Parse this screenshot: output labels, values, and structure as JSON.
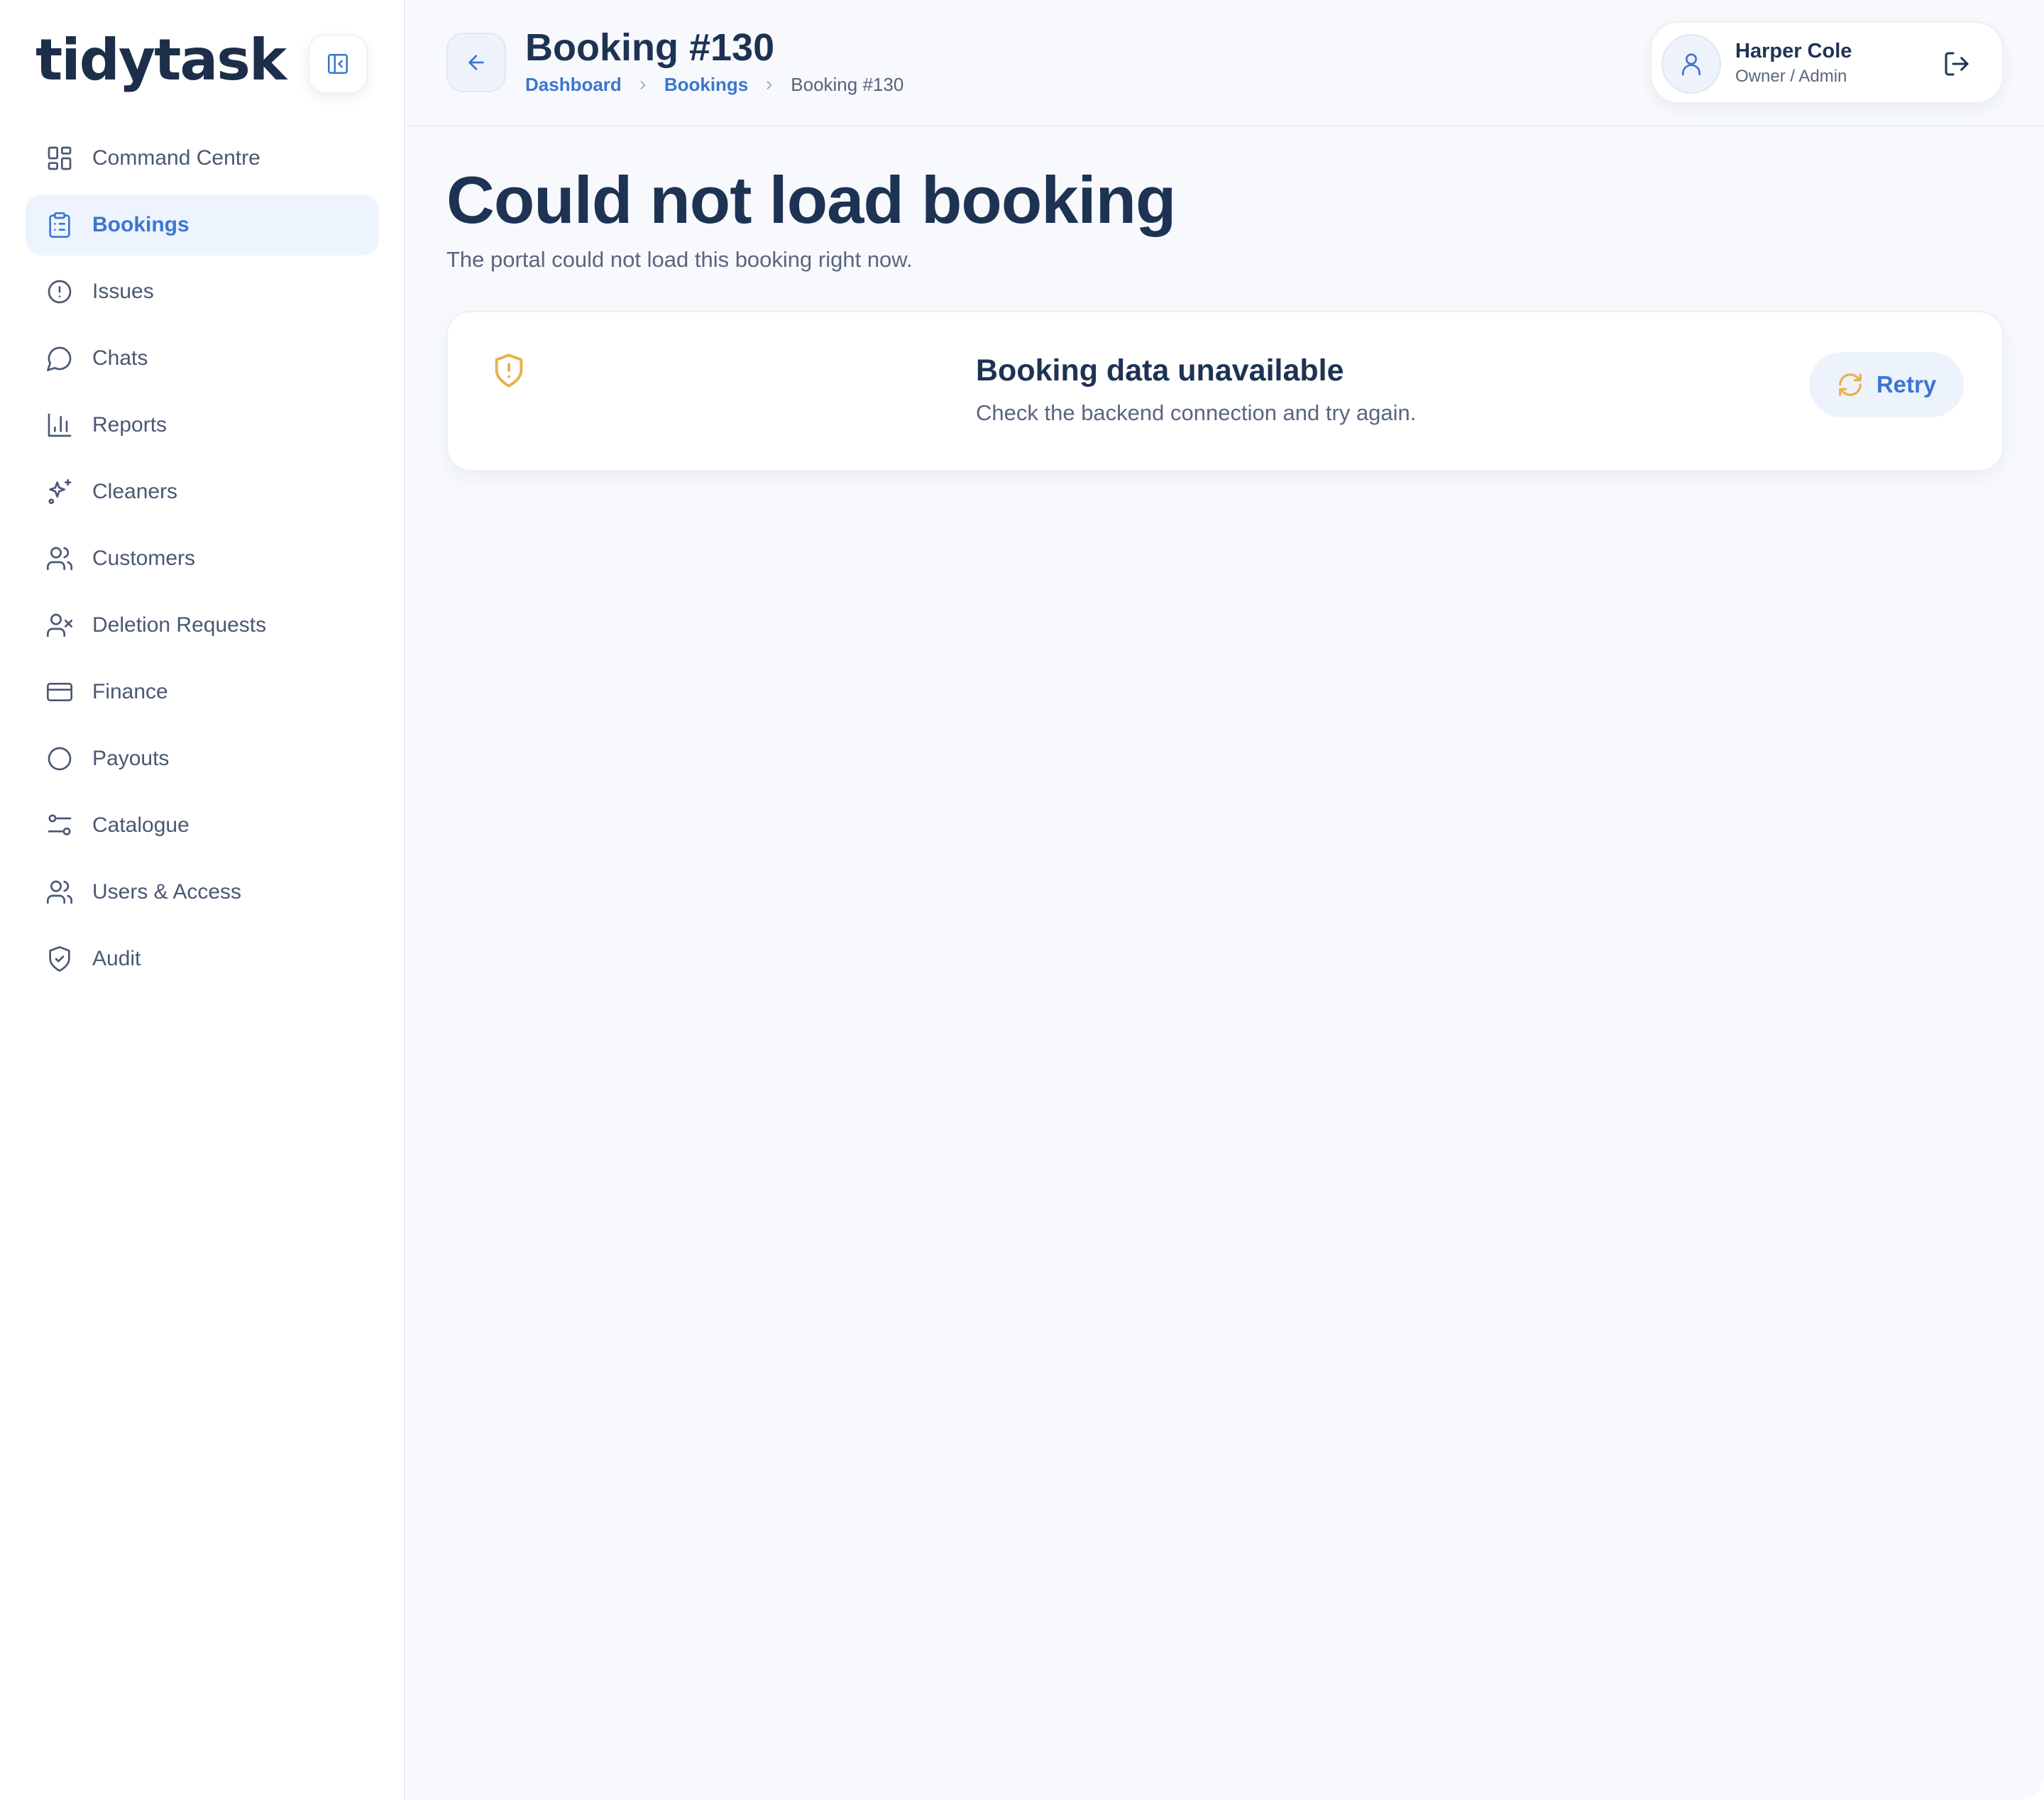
{
  "brand": {
    "logo_text": "tidytask"
  },
  "sidebar": {
    "items": [
      {
        "label": "Command Centre",
        "icon": "grid-icon",
        "active": false
      },
      {
        "label": "Bookings",
        "icon": "clipboard-icon",
        "active": true
      },
      {
        "label": "Issues",
        "icon": "alert-circle-icon",
        "active": false
      },
      {
        "label": "Chats",
        "icon": "chat-bubble-icon",
        "active": false
      },
      {
        "label": "Reports",
        "icon": "bar-chart-icon",
        "active": false
      },
      {
        "label": "Cleaners",
        "icon": "sparkles-icon",
        "active": false
      },
      {
        "label": "Customers",
        "icon": "users-icon",
        "active": false
      },
      {
        "label": "Deletion Requests",
        "icon": "user-x-icon",
        "active": false
      },
      {
        "label": "Finance",
        "icon": "credit-card-icon",
        "active": false
      },
      {
        "label": "Payouts",
        "icon": "circle-icon",
        "active": false
      },
      {
        "label": "Catalogue",
        "icon": "sliders-icon",
        "active": false
      },
      {
        "label": "Users & Access",
        "icon": "users-icon",
        "active": false
      },
      {
        "label": "Audit",
        "icon": "shield-check-icon",
        "active": false
      }
    ]
  },
  "header": {
    "title": "Booking #130",
    "breadcrumb": [
      "Dashboard",
      "Bookings",
      "Booking #130"
    ]
  },
  "user": {
    "name": "Harper Cole",
    "role": "Owner / Admin"
  },
  "main": {
    "error_title": "Could not load booking",
    "error_subtitle": "The portal could not load this booking right now.",
    "alert": {
      "title": "Booking data unavailable",
      "text": "Check the backend connection and try again.",
      "retry_label": "Retry"
    }
  },
  "colors": {
    "accent": "#3b76d1",
    "heading": "#1e3353",
    "muted": "#5a667d",
    "warning": "#e9b04a",
    "active_bg": "#eef4fd",
    "main_bg": "#f7f9fc"
  }
}
